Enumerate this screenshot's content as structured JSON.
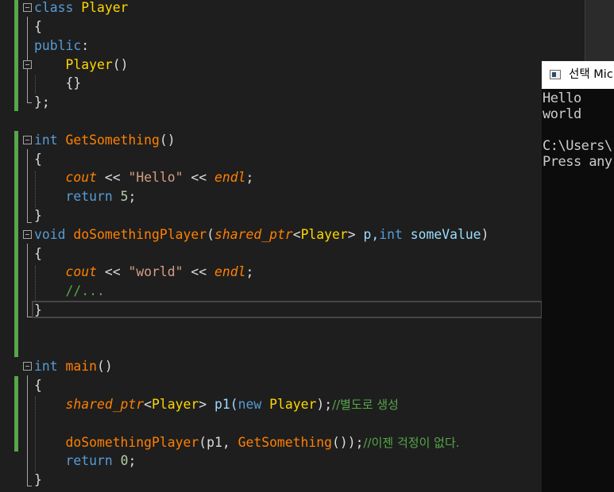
{
  "editor": {
    "lines": {
      "l0": {
        "kw1": "class",
        "name": "Player"
      },
      "l1": {
        "brace": "{"
      },
      "l2": {
        "kw": "public",
        "colon": ":"
      },
      "l3": {
        "ctor": "Player",
        "paren": "()"
      },
      "l4": {
        "body": "{}"
      },
      "l5": {
        "end": "};"
      },
      "l7": {
        "kw": "int",
        "fn": "GetSomething",
        "paren": "()"
      },
      "l8": {
        "brace": "{"
      },
      "l9": {
        "cout": "cout",
        "op1": " << ",
        "str": "\"Hello\"",
        "op2": " << ",
        "endl": "endl",
        "semi": ";"
      },
      "l10": {
        "kw": "return",
        "num": "5",
        "semi": ";"
      },
      "l11": {
        "brace": "}"
      },
      "l12": {
        "kw": "void",
        "fn": "doSomethingPlayer",
        "p1": "(",
        "type": "shared_ptr",
        "lt": "<",
        "cls": "Player",
        "gt": ">",
        "param1": " p,",
        "kw2": "int",
        "param2": " someValue",
        "p2": ")"
      },
      "l13": {
        "brace": "{"
      },
      "l14": {
        "cout": "cout",
        "op1": " << ",
        "str": "\"world\"",
        "op2": " << ",
        "endl": "endl",
        "semi": ";"
      },
      "l15": {
        "comment": "//..."
      },
      "l16": {
        "brace": "}"
      },
      "l19": {
        "kw": "int",
        "fn": "main",
        "paren": "()"
      },
      "l20": {
        "brace": "{"
      },
      "l21": {
        "type": "shared_ptr",
        "lt": "<",
        "cls": "Player",
        "gt": ">",
        "var": " p1(",
        "kw": "new",
        "sp": " ",
        "cls2": "Player",
        "end": ");",
        "comment": "//별도로 생성"
      },
      "l23": {
        "fn1": "doSomethingPlayer",
        "args": "(p1, ",
        "fn2": "GetSomething",
        "end": "());",
        "comment": "//이젠 걱정이 없다."
      },
      "l24": {
        "kw": "return",
        "num": "0",
        "semi": ";"
      },
      "l25": {
        "brace": "}"
      }
    }
  },
  "console": {
    "title": "선택 Mic",
    "lines": [
      "Hello",
      "world",
      "",
      "C:\\Users\\",
      "Press any"
    ]
  },
  "colors": {
    "keyword": "#569cd6",
    "function": "#ff8000",
    "class": "#ffd700",
    "string": "#d69d85",
    "comment": "#57a64a",
    "number": "#b5cea8",
    "text": "#dcdcdc",
    "background": "#1e1e1e"
  },
  "icons": [
    "fold-collapse-icon",
    "console-app-icon"
  ]
}
